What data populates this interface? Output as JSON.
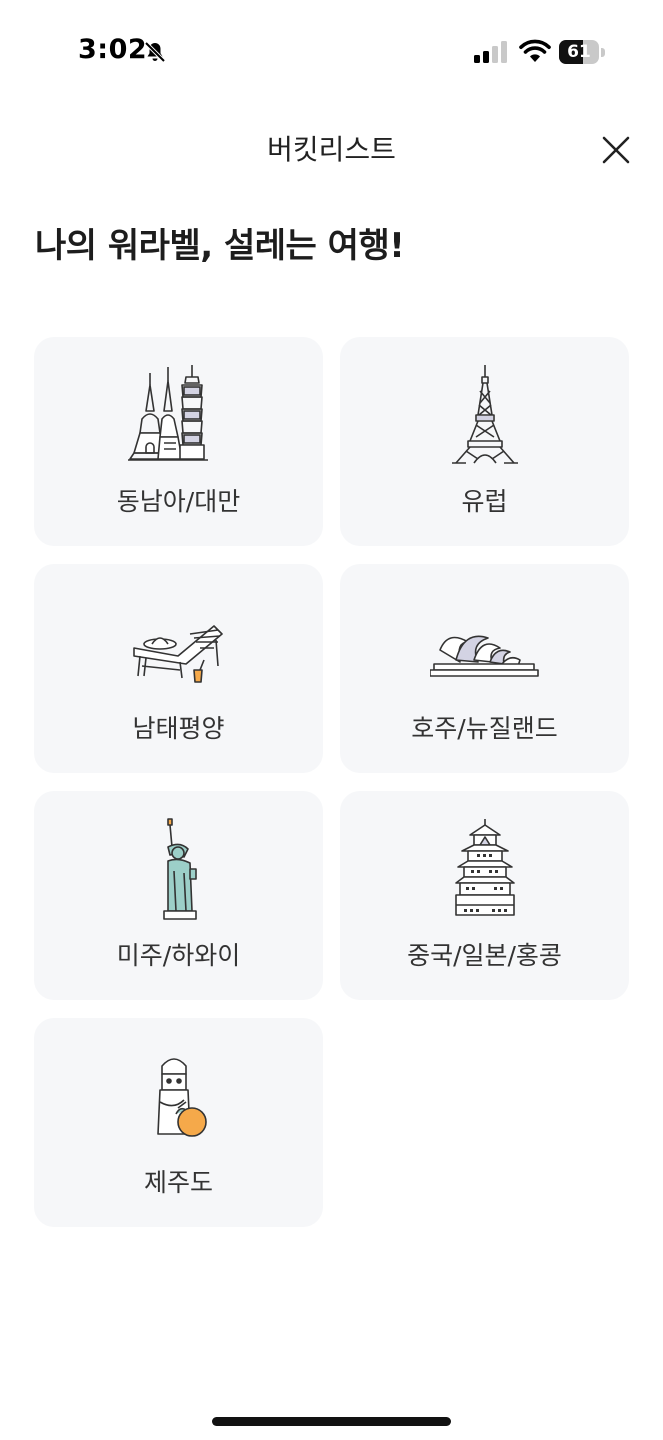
{
  "status_bar": {
    "time": "3:02",
    "battery_level": "61",
    "battery_fraction": 0.61,
    "icons": [
      "bell-slash-icon",
      "cellular-signal-icon",
      "wifi-icon",
      "battery-icon"
    ]
  },
  "header": {
    "title": "버킷리스트",
    "close_icon": "close-icon"
  },
  "heading": "나의 워라벨, 설레는 여행!",
  "destinations": [
    {
      "label": "동남아/대만",
      "icon": "temples-tower-icon"
    },
    {
      "label": "유럽",
      "icon": "eiffel-tower-icon"
    },
    {
      "label": "남태평양",
      "icon": "beach-lounger-icon"
    },
    {
      "label": "호주/뉴질랜드",
      "icon": "opera-house-icon"
    },
    {
      "label": "미주/하와이",
      "icon": "statue-of-liberty-icon"
    },
    {
      "label": "중국/일본/홍콩",
      "icon": "pagoda-castle-icon"
    },
    {
      "label": "제주도",
      "icon": "dol-hareubang-tangerine-icon"
    }
  ],
  "colors": {
    "card_background": "#f6f7f9",
    "illustration_accent_teal": "#9ccfc8",
    "illustration_accent_orange": "#f5a94a",
    "illustration_accent_lavender": "#d3d3e3"
  }
}
